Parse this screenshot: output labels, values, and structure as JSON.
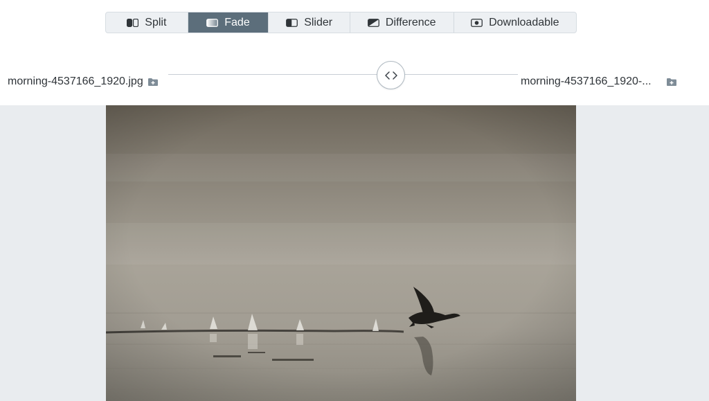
{
  "toolbar": {
    "modes": [
      {
        "label": "Split",
        "icon": "split-icon"
      },
      {
        "label": "Fade",
        "icon": "fade-icon",
        "active": true
      },
      {
        "label": "Slider",
        "icon": "slider-icon"
      },
      {
        "label": "Difference",
        "icon": "difference-icon"
      },
      {
        "label": "Downloadable",
        "icon": "downloadable-icon"
      }
    ]
  },
  "files": {
    "left": {
      "name": "morning-4537166_1920.jpg",
      "icon": "add-folder-icon"
    },
    "right": {
      "name": "morning-4537166_1920-...",
      "icon": "add-folder-icon"
    }
  },
  "fade": {
    "position": 0.5,
    "handle_icon": "code-chevrons-icon"
  },
  "colors": {
    "active_mode": "#5c6e7b",
    "toolbar_bg": "#edf0f3",
    "viewer_bg": "#e9ecef",
    "folder_icon": "#7e8c97"
  },
  "image": {
    "description_icon": "bird-photo"
  }
}
